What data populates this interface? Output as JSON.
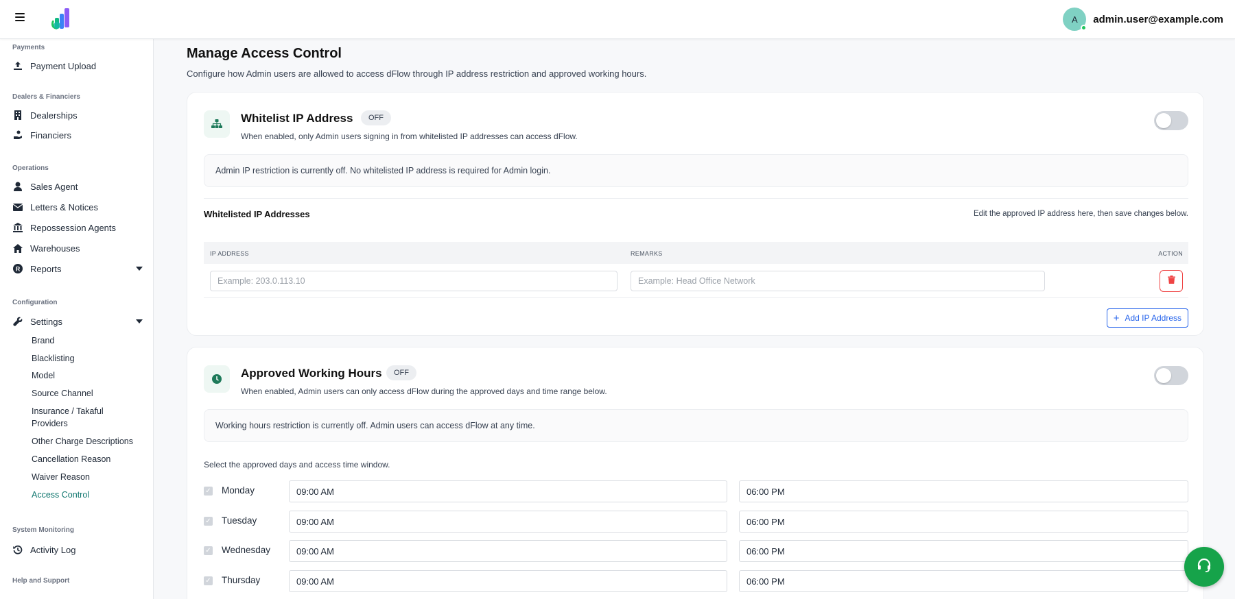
{
  "header": {
    "user_initial": "A",
    "user_email": "admin.user@example.com"
  },
  "sidebar": {
    "sections": {
      "payments": "Payments",
      "dealers": "Dealers & Financiers",
      "operations": "Operations",
      "configuration": "Configuration",
      "monitoring": "System Monitoring",
      "help": "Help and Support"
    },
    "items": {
      "payment_upload": "Payment Upload",
      "dealerships": "Dealerships",
      "financiers": "Financiers",
      "sales_agent": "Sales Agent",
      "letters_notices": "Letters & Notices",
      "repossession_agents": "Repossession Agents",
      "warehouses": "Warehouses",
      "reports": "Reports",
      "settings": "Settings",
      "activity_log": "Activity Log"
    },
    "settings_sub": [
      "Brand",
      "Blacklisting",
      "Model",
      "Source Channel",
      "Insurance / Takaful Providers",
      "Other Charge Descriptions",
      "Cancellation Reason",
      "Waiver Reason",
      "Access Control"
    ],
    "active_item": "Access Control"
  },
  "page": {
    "title": "Manage Access Control",
    "subtitle": "Configure how Admin users are allowed to access dFlow through IP address restriction and approved working hours."
  },
  "ip_card": {
    "title": "Whitelist IP Address",
    "badge": "OFF",
    "description": "When enabled, only Admin users signing in from whitelisted IP addresses can access dFlow.",
    "enabled": false,
    "notice": "Admin IP restriction is currently off. No whitelisted IP address is required for Admin login.",
    "list_title": "Whitelisted IP Addresses",
    "list_hint": "Edit the approved IP address here, then save changes below.",
    "columns": {
      "ip": "IP ADDRESS",
      "remarks": "REMARKS",
      "action": "ACTION"
    },
    "row": {
      "ip_value": "",
      "ip_placeholder": "Example: 203.0.113.10",
      "remarks_value": "",
      "remarks_placeholder": "Example: Head Office Network"
    },
    "add_button": "Add IP Address"
  },
  "hours_card": {
    "title": "Approved Working Hours",
    "badge": "OFF",
    "description": "When enabled, Admin users can only access dFlow during the approved days and time range below.",
    "enabled": false,
    "notice": "Working hours restriction is currently off. Admin users can access dFlow at any time.",
    "select_hint": "Select the approved days and access time window.",
    "days": [
      {
        "day": "Monday",
        "start": "09:00 AM",
        "end": "06:00 PM",
        "checked": true
      },
      {
        "day": "Tuesday",
        "start": "09:00 AM",
        "end": "06:00 PM",
        "checked": true
      },
      {
        "day": "Wednesday",
        "start": "09:00 AM",
        "end": "06:00 PM",
        "checked": true
      },
      {
        "day": "Thursday",
        "start": "09:00 AM",
        "end": "06:00 PM",
        "checked": true
      }
    ]
  },
  "colors": {
    "accent": "#0f766e",
    "primary_blue": "#2563eb",
    "danger": "#ef4444",
    "support_green": "#16a34a"
  },
  "icons": {
    "menu": "hamburger-icon",
    "logo": "dflow-logo-icon",
    "network": "network-icon",
    "clock": "clock-icon",
    "trash": "trash-icon",
    "headset": "headset-icon"
  }
}
